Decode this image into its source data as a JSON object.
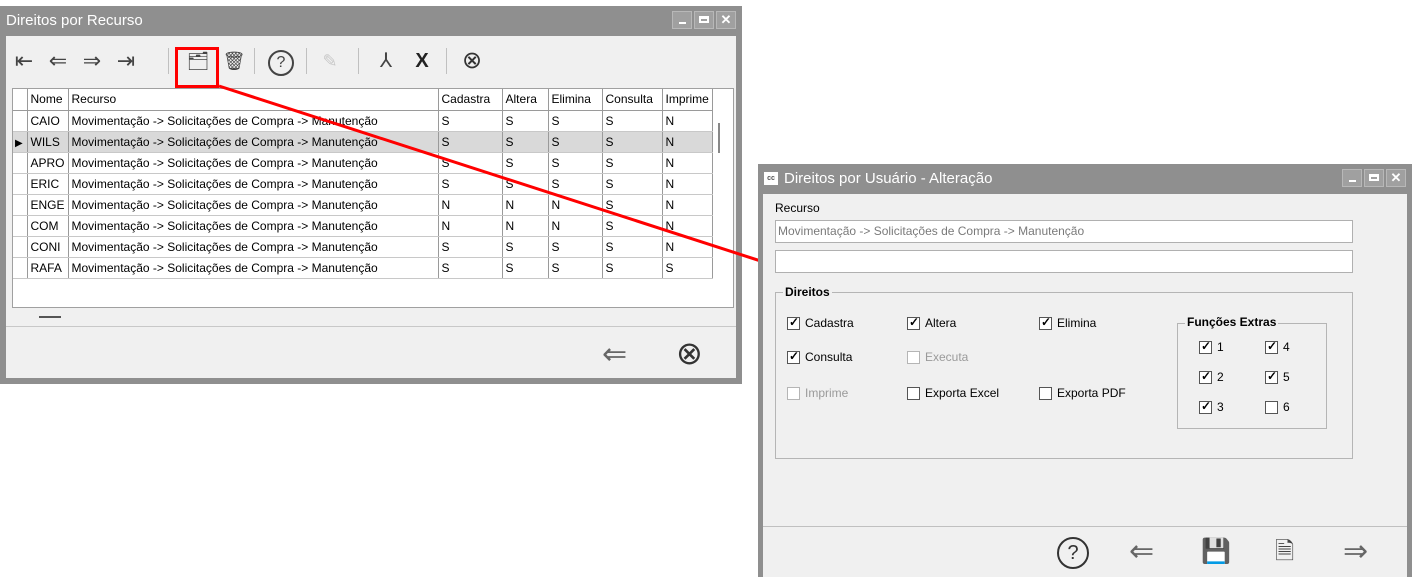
{
  "window1": {
    "title": "Direitos por Recurso",
    "toolbar": {
      "first": "⇤",
      "prev": "⇐",
      "next": "⇒",
      "last": "⇥",
      "open": "🗂",
      "delete": "🗑",
      "help": "?",
      "edit": "✎",
      "pdf": "⅄",
      "excel": "X",
      "cancel": "⊗"
    },
    "columns": [
      "Nome",
      "Recurso",
      "Cadastra",
      "Altera",
      "Elimina",
      "Consulta",
      "Imprime"
    ],
    "rows": [
      [
        "CAIO",
        "Movimentação -> Solicitações de Compra -> Manutenção",
        "S",
        "S",
        "S",
        "S",
        "N"
      ],
      [
        "WILS",
        "Movimentação -> Solicitações de Compra -> Manutenção",
        "S",
        "S",
        "S",
        "S",
        "N"
      ],
      [
        "APRO",
        "Movimentação -> Solicitações de Compra -> Manutenção",
        "S",
        "S",
        "S",
        "S",
        "N"
      ],
      [
        "ERIC",
        "Movimentação -> Solicitações de Compra -> Manutenção",
        "S",
        "S",
        "S",
        "S",
        "N"
      ],
      [
        "ENGE",
        "Movimentação -> Solicitações de Compra -> Manutenção",
        "N",
        "N",
        "N",
        "S",
        "N"
      ],
      [
        "COM",
        "Movimentação -> Solicitações de Compra -> Manutenção",
        "N",
        "N",
        "N",
        "S",
        "N"
      ],
      [
        "CONI",
        "Movimentação -> Solicitações de Compra -> Manutenção",
        "S",
        "S",
        "S",
        "S",
        "N"
      ],
      [
        "RAFA",
        "Movimentação -> Solicitações de Compra -> Manutenção",
        "S",
        "S",
        "S",
        "S",
        "S"
      ]
    ],
    "footer": {
      "back": "⇐",
      "close": "⊗"
    }
  },
  "window2": {
    "title": "Direitos por Usuário - Alteração",
    "icon_text": "cc",
    "recurso_label": "Recurso",
    "recurso_value": "Movimentação -> Solicitações de Compra -> Manutenção",
    "second_value": "",
    "direitos_title": "Direitos",
    "checks": {
      "cadastra": "Cadastra",
      "altera": "Altera",
      "elimina": "Elimina",
      "consulta": "Consulta",
      "executa": "Executa",
      "imprime": "Imprime",
      "exporta_excel": "Exporta Excel",
      "exporta_pdf": "Exporta PDF"
    },
    "extras_title": "Funções Extras",
    "extras": [
      "1",
      "2",
      "3",
      "4",
      "5",
      "6"
    ],
    "footer": {
      "help": "?",
      "back": "⇐",
      "save": "💾",
      "cancel": "🗎",
      "next": "⇒"
    }
  },
  "icons": {
    "first": "first-icon",
    "prev": "previous-icon",
    "next": "next-icon",
    "last": "last-icon",
    "open": "open-record-icon",
    "delete": "trash-icon",
    "help": "help-icon",
    "edit": "edit-icon",
    "pdf": "pdf-icon",
    "excel": "excel-icon",
    "cancel": "cancel-icon",
    "save": "save-icon"
  },
  "colors": {
    "annotation": "#ff0000",
    "titlebar": "#8f8f8f",
    "selected_row": "#d9d9d9"
  }
}
